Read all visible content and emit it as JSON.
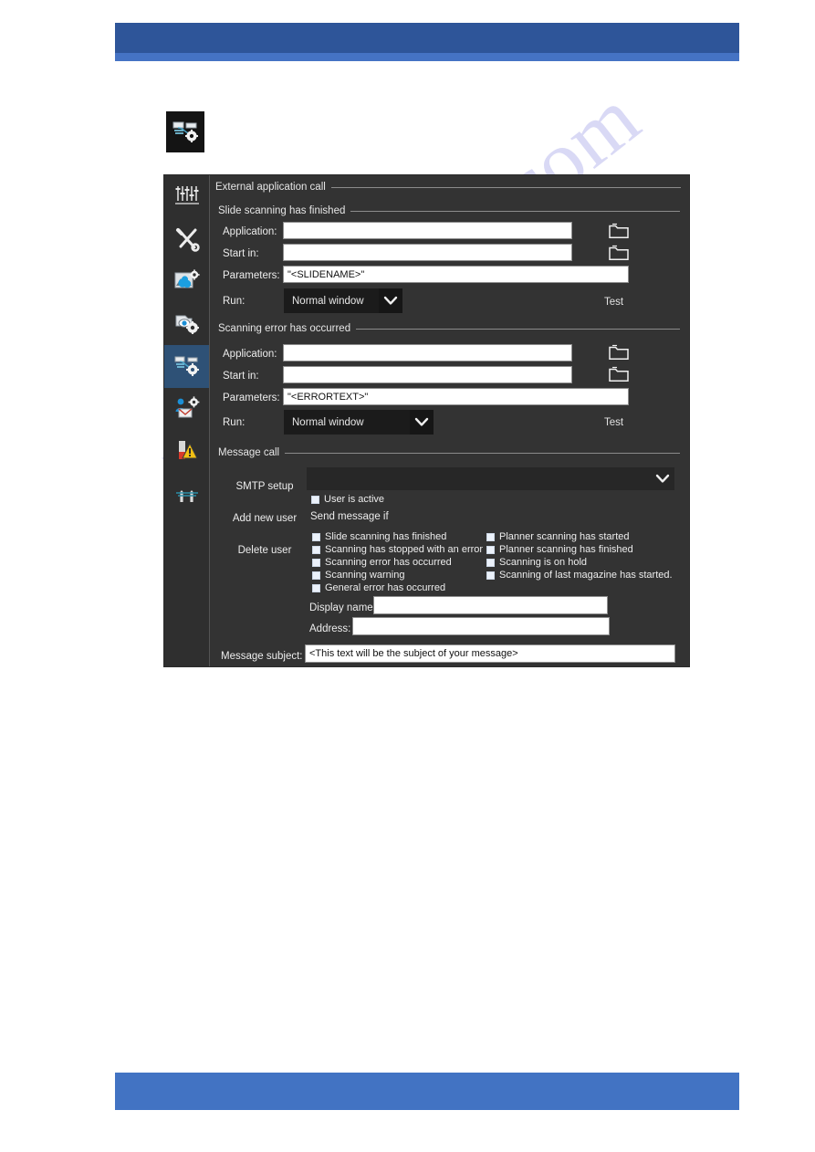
{
  "theme": {
    "header_blue": "#2e5599",
    "header_accent_blue": "#4573c4",
    "footer_blue": "#4273c3",
    "dialog_bg": "#333333",
    "sidebar_bg": "#2f2f2f",
    "selected_item_bg": "#2e5176",
    "field_bg": "#ffffff",
    "combo_bg": "#1b1b1b",
    "text": "#ededed"
  },
  "watermark": {
    "text": "manualslive.com"
  },
  "standalone_icon": {
    "name": "external-application-call-icon"
  },
  "sidebar": {
    "items": [
      {
        "name": "sliders-settings-icon",
        "selected": false
      },
      {
        "name": "tools-wrench-screwdriver-icon",
        "selected": false
      },
      {
        "name": "image-color-settings-icon",
        "selected": false
      },
      {
        "name": "camera-eye-settings-icon",
        "selected": false
      },
      {
        "name": "external-application-call-icon",
        "selected": true
      },
      {
        "name": "user-mail-settings-icon",
        "selected": false
      },
      {
        "name": "warning-alert-icon",
        "selected": false
      },
      {
        "name": "calibration-tools-icon",
        "selected": false
      }
    ]
  },
  "dialog": {
    "groups": {
      "external_application_call": "External application call",
      "slide_scanning_finished": "Slide scanning has finished",
      "scanning_error_occurred": "Scanning error has occurred",
      "message_call": "Message call"
    },
    "slide_scanning": {
      "application_label": "Application:",
      "application_value": "",
      "start_in_label": "Start in:",
      "start_in_value": "",
      "parameters_label": "Parameters:",
      "parameters_value": "\"<SLIDENAME>\"",
      "run_label": "Run:",
      "run_value": "Normal window",
      "test_label": "Test",
      "browse_application_icon": "folder-icon",
      "browse_start_in_icon": "folder-icon"
    },
    "scanning_error": {
      "application_label": "Application:",
      "application_value": "",
      "start_in_label": "Start in:",
      "start_in_value": "",
      "parameters_label": "Parameters:",
      "parameters_value": "\"<ERRORTEXT>\"",
      "run_label": "Run:",
      "run_value": "Normal window",
      "test_label": "Test",
      "browse_application_icon": "folder-icon",
      "browse_start_in_icon": "folder-icon"
    },
    "message_call": {
      "smtp_setup_label": "SMTP setup",
      "add_new_user_label": "Add new user",
      "delete_user_label": "Delete user",
      "smtp_select_value": "",
      "user_is_active_label": "User is active",
      "user_is_active_checked": false,
      "send_message_if_label": "Send message if",
      "conditions_left": [
        {
          "label": "Slide scanning has finished",
          "checked": false
        },
        {
          "label": "Scanning has stopped with an error",
          "checked": false
        },
        {
          "label": "Scanning error has occurred",
          "checked": false
        },
        {
          "label": "Scanning warning",
          "checked": false
        },
        {
          "label": "General error has occurred",
          "checked": false
        }
      ],
      "conditions_right": [
        {
          "label": "Planner scanning has started",
          "checked": false
        },
        {
          "label": "Planner scanning has finished",
          "checked": false
        },
        {
          "label": "Scanning is on hold",
          "checked": false
        },
        {
          "label": "Scanning of last magazine has started.",
          "checked": false
        }
      ],
      "display_name_label": "Display name:",
      "display_name_value": "",
      "address_label": "Address:",
      "address_value": "",
      "message_subject_label": "Message subject:",
      "message_subject_value": "<This text will be the subject of your message>"
    }
  }
}
